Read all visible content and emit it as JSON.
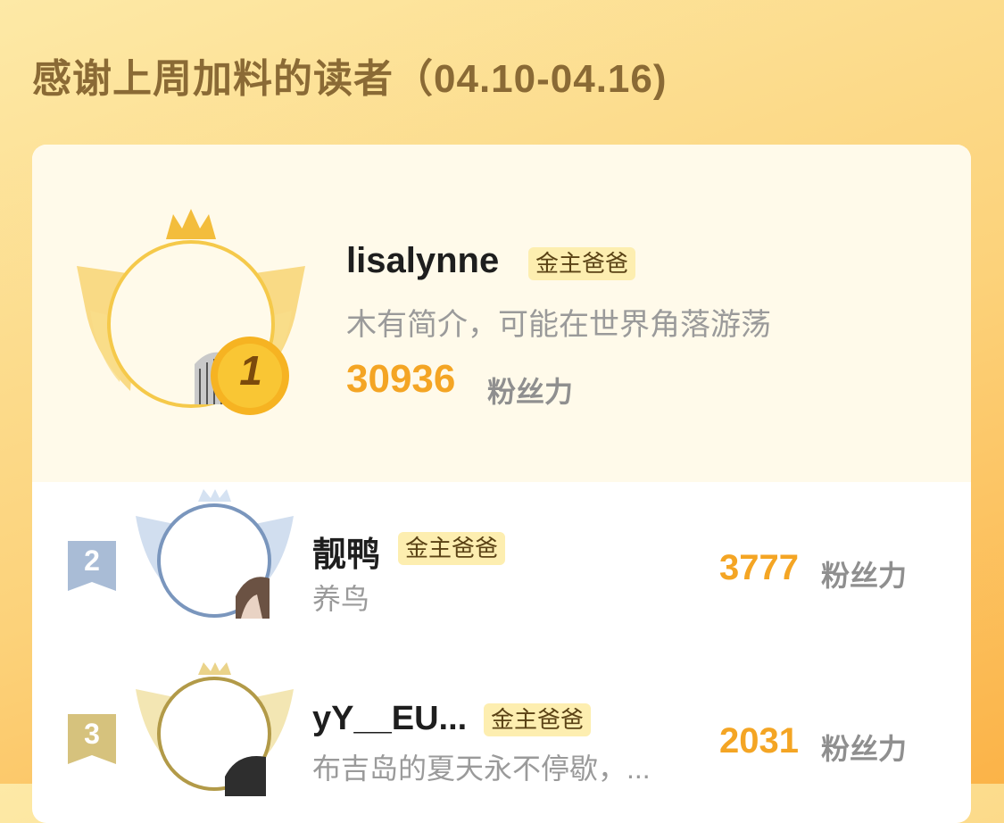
{
  "header": {
    "title": "感谢上周加料的读者（04.10-04.16)"
  },
  "leaderboard": {
    "top": {
      "rank": "1",
      "name": "lisalynne",
      "badge": "金主爸爸",
      "bio": "木有简介，可能在世界角落游荡",
      "score": "30936",
      "score_unit": "粉丝力"
    },
    "others": [
      {
        "rank": "2",
        "name": "靓鸭",
        "badge": "金主爸爸",
        "bio": "养鸟",
        "score": "3777",
        "score_unit": "粉丝力"
      },
      {
        "rank": "3",
        "name": "yY__EU...",
        "badge": "金主爸爸",
        "bio": "布吉岛的夏天永不停歇，...",
        "score": "2031",
        "score_unit": "粉丝力"
      }
    ]
  },
  "colors": {
    "gold": "#f4a524",
    "silver": "#7a96bd",
    "bronze": "#b29a48"
  }
}
